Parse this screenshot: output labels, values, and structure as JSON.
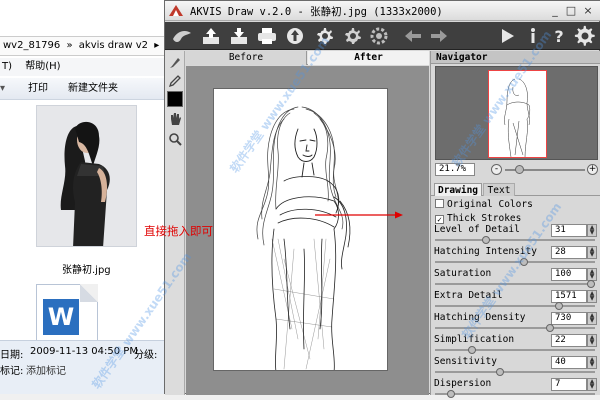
{
  "explorer": {
    "breadcrumb": [
      "wv2_81796",
      "»",
      "akvis draw v2",
      "▸"
    ],
    "menu": [
      "T)",
      "帮助(H)"
    ],
    "toolbar": {
      "print": "打印",
      "new_folder": "新建文件夹"
    },
    "file1_name": "张静初.jpg",
    "file2_icon_letter": "W",
    "details": {
      "date_label": "日期:",
      "date_value": "2009-11-13 04:50 PM",
      "cat_label": "分级:",
      "tag_label": "标记:",
      "tag_value": "添加标记"
    }
  },
  "window": {
    "title": "AKVIS Draw v.2.0 - 张静初.jpg (1333x2000)",
    "controls": [
      "_",
      "□",
      "×"
    ]
  },
  "toolbar_icons": [
    "logo-icon",
    "open-icon",
    "save-icon",
    "print-icon",
    "upload-icon",
    "settings-export-icon",
    "settings-import-icon",
    "gear-icon",
    "undo-icon",
    "redo-icon",
    "run-icon",
    "info-icon",
    "help-icon",
    "preferences-icon"
  ],
  "tools": [
    "brush-icon",
    "pencil-icon",
    "color-swatch",
    "hand-icon",
    "zoom-icon"
  ],
  "canvas": {
    "tab_before": "Before",
    "tab_after": "After"
  },
  "annotation": {
    "text": "直接拖入即可",
    "color": "#e00000"
  },
  "navigator": {
    "title": "Navigator",
    "zoom": "21.7%",
    "minus": "-",
    "plus": "+"
  },
  "settings": {
    "tabs": [
      "Drawing",
      "Text"
    ],
    "checkboxes": [
      {
        "label": "Original Colors",
        "checked": false
      },
      {
        "label": "Thick Strokes",
        "checked": true
      }
    ],
    "params": [
      {
        "label": "Level of Detail",
        "value": "31",
        "level": 0.31
      },
      {
        "label": "Hatching Intensity",
        "value": "28",
        "level": 0.56
      },
      {
        "label": "Saturation",
        "value": "100",
        "level": 1.0
      },
      {
        "label": "Extra Detail",
        "value": "1571",
        "level": 0.79
      },
      {
        "label": "Hatching Density",
        "value": "730",
        "level": 0.73
      },
      {
        "label": "Simplification",
        "value": "22",
        "level": 0.22
      },
      {
        "label": "Sensitivity",
        "value": "40",
        "level": 0.4
      },
      {
        "label": "Dispersion",
        "value": "7",
        "level": 0.08
      }
    ]
  },
  "watermark": "软件学堂 www.xue51.com",
  "colors": {
    "toolbar_bg": "#3f3f3f",
    "annotation": "#e00000",
    "nav_frame": "#e44444"
  }
}
